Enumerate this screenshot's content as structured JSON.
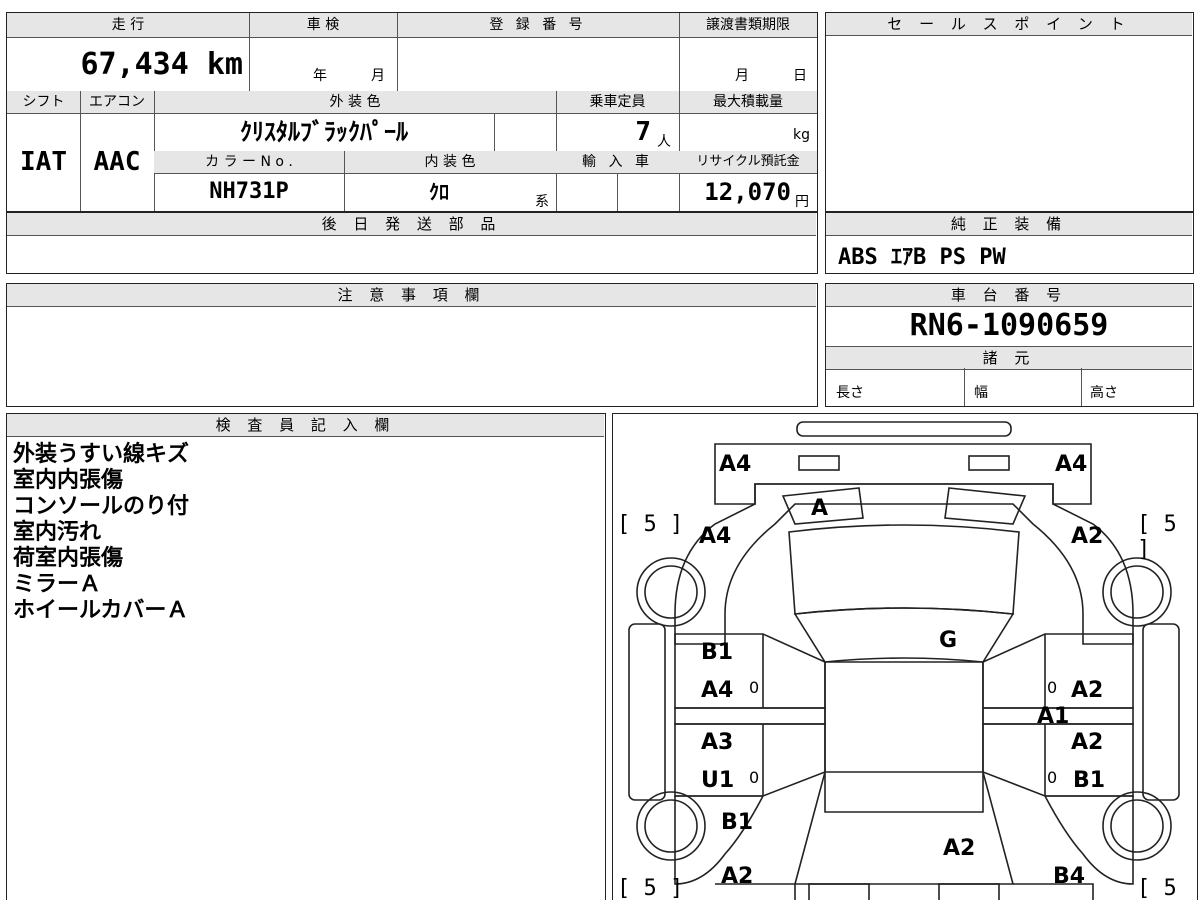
{
  "top": {
    "mileage_label": "走 行",
    "mileage_value": "67,434 km",
    "inspection_label": "車 検",
    "inspection_year": "年",
    "inspection_month": "月",
    "reg_label": "登 録 番 号",
    "transfer_label": "譲渡書類期限",
    "transfer_month": "月",
    "transfer_day": "日",
    "shift_label": "シフト",
    "shift_value": "IAT",
    "ac_label": "エアコン",
    "ac_value": "AAC",
    "ext_color_label": "外 装 色",
    "ext_color_value": "ｸﾘｽﾀﾙﾌﾞﾗｯｸﾊﾟｰﾙ",
    "capacity_label": "乗車定員",
    "capacity_value": "7",
    "capacity_unit": "人",
    "load_label": "最大積載量",
    "load_unit": "kg",
    "color_no_label": "カ ラ ー N o .",
    "color_no_value": "NH731P",
    "int_color_label": "内 装 色",
    "int_color_value": "ｸﾛ",
    "int_color_suffix": "系",
    "import_label": "輸 入 車",
    "recycle_label": "リサイクル預託金",
    "recycle_value": "12,070",
    "recycle_unit": "円",
    "later_parts_label": "後 日 発 送 部 品"
  },
  "sales": {
    "label": "セ ー ル ス ポ イ ン ト"
  },
  "equipment": {
    "label": "純 正 装 備",
    "value": "ABS ｴｱB PS PW"
  },
  "notes": {
    "label": "注 意 事 項 欄"
  },
  "chassis": {
    "label": "車 台 番 号",
    "value": "RN6-1090659",
    "spec_label": "諸 元",
    "length": "長さ",
    "width": "幅",
    "height": "高さ"
  },
  "inspector": {
    "label": "検 査 員 記 入 欄",
    "lines": [
      "外装うすい線キズ",
      "室内内張傷",
      "コンソールのり付",
      "室内汚れ",
      "荷室内張傷",
      "ミラーＡ",
      "ホイールカバーＡ"
    ]
  },
  "diagram": {
    "marks": {
      "a4_front_left": "A4",
      "a4_front_right": "A4",
      "a_windshield": "A",
      "a4_fender_left": "A4",
      "a2_fender_right": "A2",
      "g_roof": "G",
      "b1_front_door_left": "B1",
      "a4_front_door_left": "A4",
      "a2_front_door_right": "A2",
      "a1_pillar_right": "A1",
      "a3_rear_door_left": "A3",
      "u1_rear_door_left": "U1",
      "a2_rear_door_right": "A2",
      "b1_rear_door_right": "B1",
      "b1_rear_fender_left": "B1",
      "a2_rear_center": "A2",
      "a2_rear_left": "A2",
      "b4_rear_right": "B4"
    },
    "tire_marks": [
      "[ 5 ]",
      "[ 5 ]",
      "[ 5 ]",
      "[ 5 ]"
    ],
    "zero": "0"
  }
}
